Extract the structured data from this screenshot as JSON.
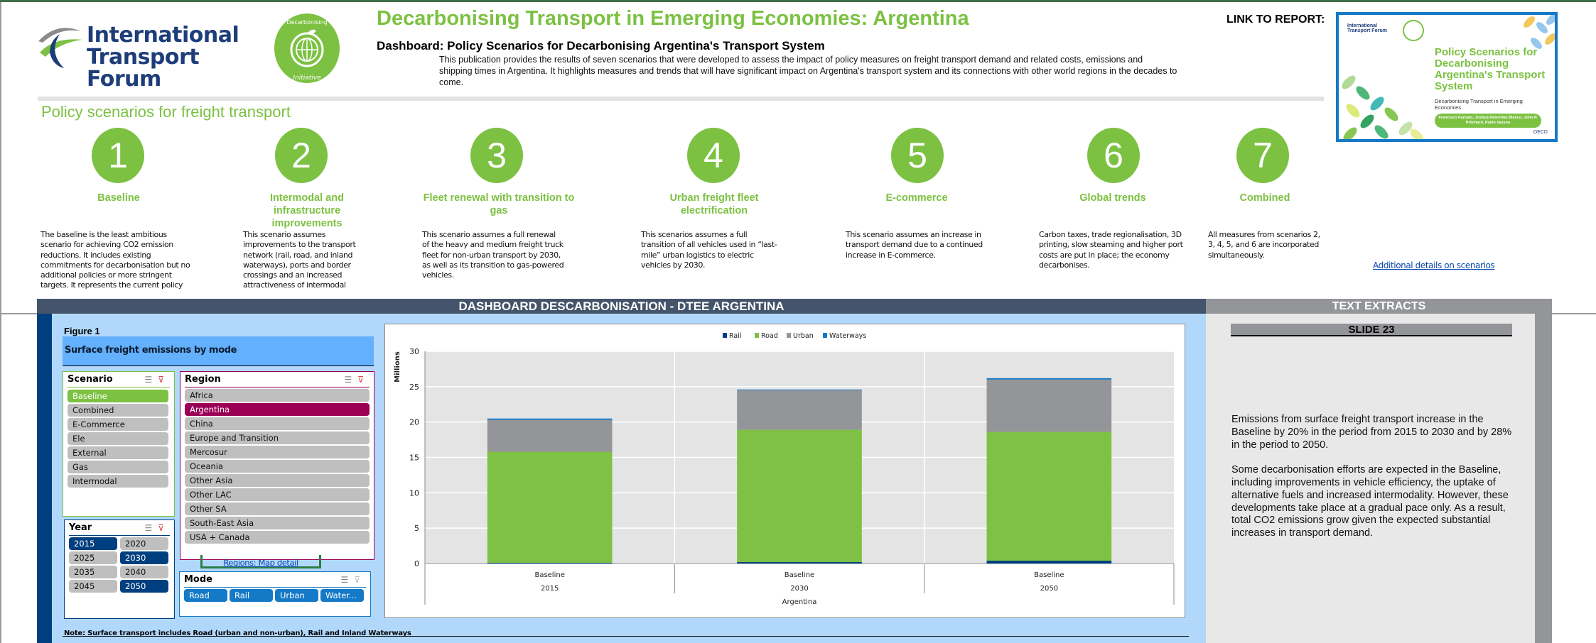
{
  "header": {
    "org_name_line1": "International",
    "org_name_line2": "Transport Forum",
    "initiative_badge": "Decarbonising Transport Initiative",
    "title": "Decarbonising Transport in Emerging Economies: Argentina",
    "subtitle": "Dashboard: Policy Scenarios for Decarbonising Argentina's Transport System",
    "intro": "This publication provides the results of seven scenarios that were developed to assess the impact of policy measures on freight transport demand and related costs, emissions and shipping times in Argentina. It highlights measures and trends that will have significant impact on Argentina's transport system and its connections with other world regions in the decades to come.",
    "link_label": "LINK TO REPORT:",
    "brand_green": "#7cc142",
    "brand_navy": "#1d3d7a"
  },
  "report_cover": {
    "itf": "International Transport Forum",
    "title": "Policy Scenarios for Decarbonising Argentina's Transport System",
    "subtitle": "Decarbonising Transport in Emerging Economies",
    "authors": "Francisco Furtado, Joshua Paternina Blanco, John P. Pritchard, Pablo Vazano",
    "publisher": "OECD"
  },
  "scenarios_section": {
    "title": "Policy scenarios for freight transport",
    "more_link": "Additional details on scenarios",
    "items": [
      {
        "number": "1",
        "title": "Baseline",
        "description": "The baseline is the least ambitious scenario for achieving CO2 emission reductions. It includes existing commitments for decarbonisation but no additional policies or more stringent targets. It represents the current policy"
      },
      {
        "number": "2",
        "title": "Intermodal and infrastructure improvements",
        "description": "This scenario assumes improvements to the transport network (rail, road, and inland waterways), ports and border crossings and an increased attractiveness of intermodal"
      },
      {
        "number": "3",
        "title": "Fleet renewal with transition to gas",
        "description": "This scenario assumes a full renewal of the heavy and medium freight truck fleet for non-urban transport by 2030, as well as its transition to gas-powered vehicles."
      },
      {
        "number": "4",
        "title": "Urban freight fleet electrification",
        "description": "This scenarios assumes a full transition of all vehicles used in “last-mile” urban logistics to electric vehicles by 2030."
      },
      {
        "number": "5",
        "title": "E-commerce",
        "description": "This scenario assumes an increase in transport demand due to a continued increase in E-commerce."
      },
      {
        "number": "6",
        "title": "Global trends",
        "description": "Carbon taxes, trade regionalisation, 3D printing, slow steaming and higher port costs are put in place; the economy decarbonises."
      },
      {
        "number": "7",
        "title": "Combined",
        "description": "All measures from scenarios 2, 3, 4, 5, and 6 are incorporated simultaneously."
      }
    ]
  },
  "dashboard": {
    "header": "DASHBOARD DESCARBONISATION - DTEE ARGENTINA",
    "figure_label": "Figure 1",
    "figure_title": "Surface freight emissions by mode",
    "map_link": "Regions: Map detail",
    "note": "Note: Surface transport includes Road (urban and non-urban), Rail and Inland Waterways",
    "slicers": {
      "scenario": {
        "title": "Scenario",
        "selected_color": "#7cc142",
        "items": [
          {
            "label": "Baseline",
            "selected": true
          },
          {
            "label": "Combined",
            "selected": false
          },
          {
            "label": "E-Commerce",
            "selected": false
          },
          {
            "label": "Ele",
            "selected": false
          },
          {
            "label": "External",
            "selected": false
          },
          {
            "label": "Gas",
            "selected": false
          },
          {
            "label": "Intermodal",
            "selected": false
          }
        ]
      },
      "region": {
        "title": "Region",
        "selected_color": "#9b0056",
        "items": [
          {
            "label": "Africa",
            "selected": false
          },
          {
            "label": "Argentina",
            "selected": true
          },
          {
            "label": "China",
            "selected": false
          },
          {
            "label": "Europe and Transition",
            "selected": false
          },
          {
            "label": "Mercosur",
            "selected": false
          },
          {
            "label": "Oceania",
            "selected": false
          },
          {
            "label": "Other Asia",
            "selected": false
          },
          {
            "label": "Other LAC",
            "selected": false
          },
          {
            "label": "Other SA",
            "selected": false
          },
          {
            "label": "South-East Asia",
            "selected": false
          },
          {
            "label": "USA + Canada",
            "selected": false
          }
        ]
      },
      "year": {
        "title": "Year",
        "selected_color": "#003f7f",
        "items": [
          {
            "label": "2015",
            "selected": true
          },
          {
            "label": "2020",
            "selected": false
          },
          {
            "label": "2025",
            "selected": false
          },
          {
            "label": "2030",
            "selected": true
          },
          {
            "label": "2035",
            "selected": false
          },
          {
            "label": "2040",
            "selected": false
          },
          {
            "label": "2045",
            "selected": false
          },
          {
            "label": "2050",
            "selected": true
          }
        ]
      },
      "mode": {
        "title": "Mode",
        "selected_color": "#1479c6",
        "items": [
          {
            "label": "Road",
            "selected": true
          },
          {
            "label": "Rail",
            "selected": true
          },
          {
            "label": "Urban",
            "selected": true
          },
          {
            "label": "Water...",
            "selected": true
          }
        ]
      }
    }
  },
  "chart_data": {
    "type": "bar",
    "stacked": true,
    "title": "Surface freight emissions by mode",
    "ylabel": "Millions",
    "xlabel": "Argentina",
    "ylim": [
      0,
      30
    ],
    "yticks": [
      0,
      5,
      10,
      15,
      20,
      25,
      30
    ],
    "grid": true,
    "legend_position": "top-right",
    "categories": [
      {
        "scenario": "Baseline",
        "year": "2015"
      },
      {
        "scenario": "Baseline",
        "year": "2030"
      },
      {
        "scenario": "Baseline",
        "year": "2050"
      }
    ],
    "series": [
      {
        "name": "Rail",
        "color": "#003f7f",
        "values": [
          0.1,
          0.2,
          0.4
        ]
      },
      {
        "name": "Road",
        "color": "#7fc144",
        "values": [
          15.7,
          18.7,
          18.2
        ]
      },
      {
        "name": "Urban",
        "color": "#939598",
        "values": [
          4.5,
          5.6,
          7.4
        ]
      },
      {
        "name": "Waterways",
        "color": "#1479c6",
        "values": [
          0.2,
          0.1,
          0.2
        ]
      }
    ]
  },
  "text_extracts": {
    "header": "TEXT EXTRACTS",
    "slide": "SLIDE 23",
    "paragraphs": [
      "Emissions from surface freight transport increase in the Baseline by 20% in the period from 2015 to 2030 and by 28% in the period to 2050.",
      "Some decarbonisation efforts are expected in the Baseline, including improvements in vehicle efficiency, the uptake of alternative fuels and increased intermodality. However, these developments take place at a gradual pace only. As a result, total CO2 emissions grow given the expected substantial increases in transport demand."
    ]
  }
}
